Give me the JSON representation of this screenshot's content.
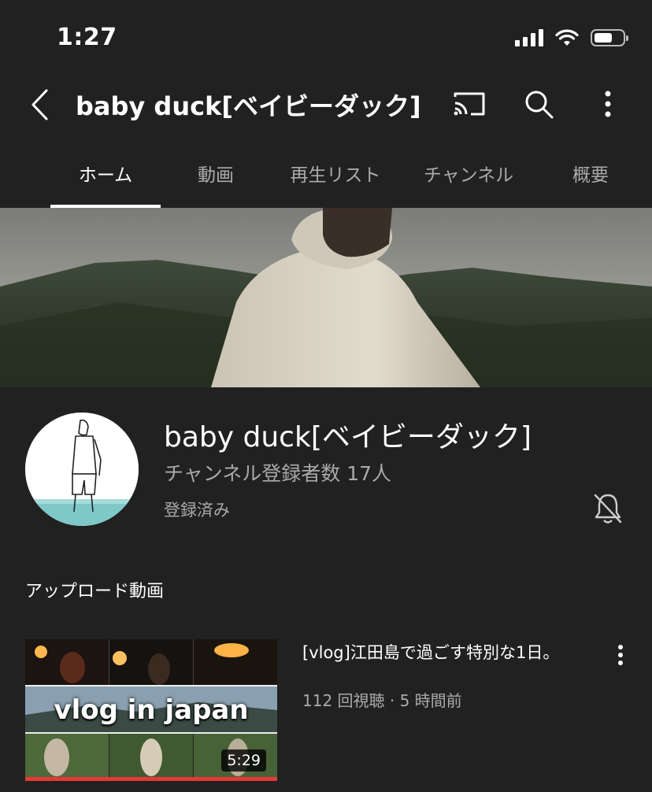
{
  "status_bar": {
    "time": "1:27"
  },
  "header": {
    "title": "baby duck[ベイビーダック]",
    "icons": [
      "back-icon",
      "cast-icon",
      "search-icon",
      "more-vert-icon"
    ]
  },
  "tabs": [
    {
      "label": "ホーム",
      "active": true
    },
    {
      "label": "動画",
      "active": false
    },
    {
      "label": "再生リスト",
      "active": false
    },
    {
      "label": "チャンネル",
      "active": false
    },
    {
      "label": "概要",
      "active": false
    }
  ],
  "channel": {
    "name": "baby duck[ベイビーダック]",
    "subscribers": "チャンネル登録者数 17人",
    "subscribe_state": "登録済み",
    "notification_icon": "bell-off-icon"
  },
  "section": {
    "title": "アップロード動画"
  },
  "videos": [
    {
      "title": "[vlog]江田島で過ごす特別な1日。",
      "meta": "112 回視聴 · 5 時間前",
      "duration": "5:29",
      "thumbnail_text": "vlog in japan"
    }
  ],
  "colors": {
    "background": "#212121",
    "text_primary": "#ffffff",
    "text_secondary": "#aaaaaa",
    "progress": "#e53935"
  }
}
